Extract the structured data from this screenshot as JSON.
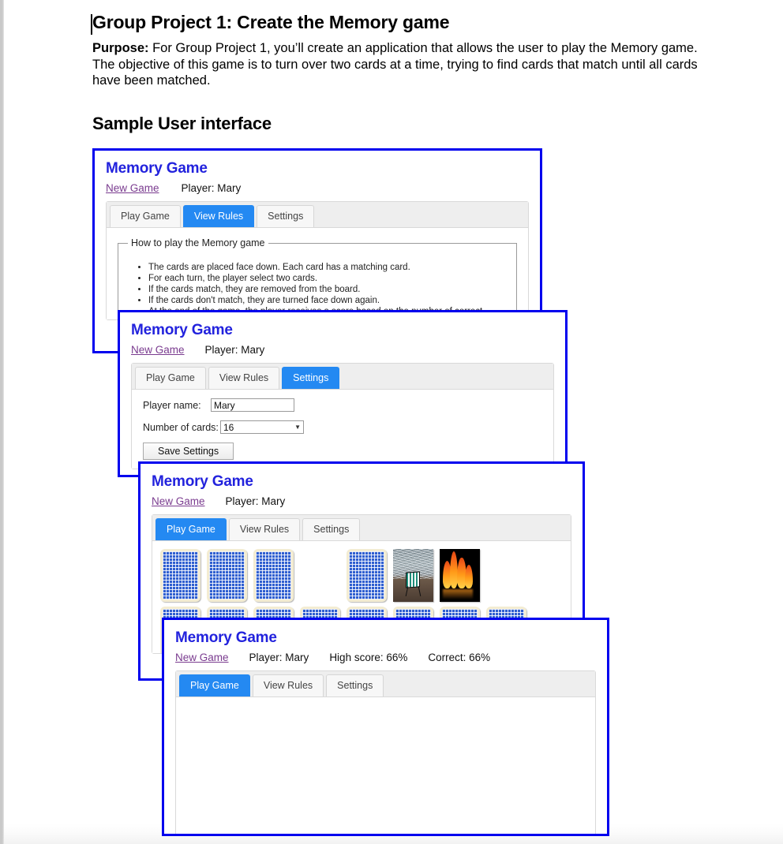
{
  "document": {
    "heading": "Group Project 1: Create the Memory game",
    "purpose_label": "Purpose:",
    "purpose_text": " For Group Project 1, you’ll create an application that allows the user to play the Memory game. The objective of this game is to turn over two cards at a time, trying to find cards that match until all cards have been matched.",
    "subheading": "Sample User interface"
  },
  "colors": {
    "window_border": "#0000ee",
    "app_title": "#2222dd",
    "active_tab": "#2489f2",
    "link": "#7a3b8f"
  },
  "app": {
    "title": "Memory Game",
    "new_game_link": "New Game",
    "tabs": [
      "Play Game",
      "View Rules",
      "Settings"
    ]
  },
  "window1": {
    "title": "Memory Game",
    "new_game_link": "New Game",
    "player_status": "Player: Mary",
    "tabs": [
      {
        "label": "Play Game",
        "active": false
      },
      {
        "label": "View Rules",
        "active": true
      },
      {
        "label": "Settings",
        "active": false
      }
    ],
    "rules_legend": "How to play the Memory game",
    "rules": [
      "The cards are placed face down. Each card has a matching card.",
      "For each turn, the player select two cards.",
      "If the cards match, they are removed from the board.",
      "If the cards don't match, they are turned face down again.",
      "At the end of the game, the player receives a score based on the number of correct"
    ]
  },
  "window2": {
    "title": "Memory Game",
    "new_game_link": "New Game",
    "player_status": "Player: Mary",
    "tabs": [
      {
        "label": "Play Game",
        "active": false
      },
      {
        "label": "View Rules",
        "active": false
      },
      {
        "label": "Settings",
        "active": true
      }
    ],
    "player_name_label": "Player name:",
    "player_name_value": "Mary",
    "number_of_cards_label": "Number of cards:",
    "number_of_cards_value": "16",
    "number_of_cards_options": [
      "16"
    ],
    "save_button": "Save Settings"
  },
  "window3": {
    "title": "Memory Game",
    "new_game_link": "New Game",
    "player_status": "Player: Mary",
    "tabs": [
      {
        "label": "Play Game",
        "active": true
      },
      {
        "label": "View Rules",
        "active": false
      },
      {
        "label": "Settings",
        "active": false
      }
    ],
    "cards": [
      "back",
      "back",
      "back",
      "empty",
      "back",
      "beach",
      "fire",
      "empty",
      "back",
      "back",
      "back",
      "back",
      "back",
      "back",
      "back",
      "back"
    ]
  },
  "window4": {
    "title": "Memory Game",
    "new_game_link": "New Game",
    "player_status": "Player: Mary",
    "high_score": "High score: 66%",
    "correct": "Correct: 66%",
    "tabs": [
      {
        "label": "Play Game",
        "active": true
      },
      {
        "label": "View Rules",
        "active": false
      },
      {
        "label": "Settings",
        "active": false
      }
    ],
    "cards": []
  }
}
